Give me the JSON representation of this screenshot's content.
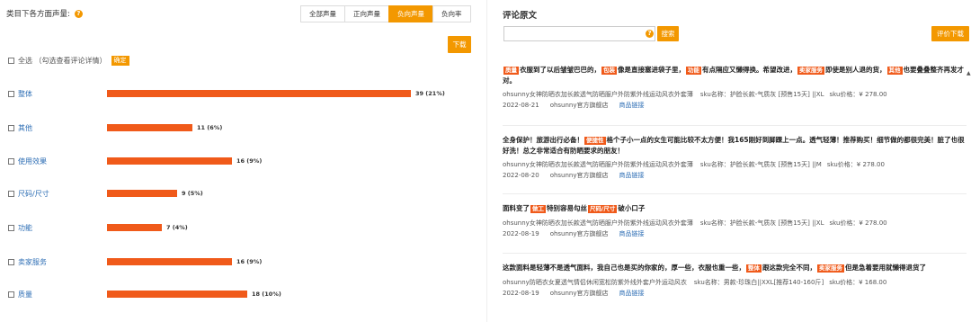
{
  "left": {
    "title": "类目下各方面声量:",
    "help": "?",
    "tabs": [
      "全部声量",
      "正向声量",
      "负向声量",
      "负向率"
    ],
    "active_tab": 2,
    "download_label": "下载",
    "select_all_label": "全选 （勾选查看评论详情）",
    "confirm_label": "确定",
    "aspects": [
      {
        "name": "整体",
        "count": 39,
        "share": "21%",
        "label": "39 (21%)"
      },
      {
        "name": "其他",
        "count": 11,
        "share": "6%",
        "label": "11 (6%)"
      },
      {
        "name": "使用效果",
        "count": 16,
        "share": "9%",
        "label": "16 (9%)"
      },
      {
        "name": "尺码/尺寸",
        "count": 9,
        "share": "5%",
        "label": "9 (5%)"
      },
      {
        "name": "功能",
        "count": 7,
        "share": "4%",
        "label": "7 (4%)"
      },
      {
        "name": "卖家服务",
        "count": 16,
        "share": "9%",
        "label": "16 (9%)"
      },
      {
        "name": "质量",
        "count": 18,
        "share": "10%",
        "label": "18 (10%)"
      }
    ]
  },
  "right": {
    "title": "评论原文",
    "search_placeholder": "",
    "search_label": "搜索",
    "download_label": "评价下载",
    "comments": [
      {
        "segments": [
          {
            "tag": "质量"
          },
          {
            "text": "衣服到了以后皱皱巴巴的，"
          },
          {
            "tag": "包装"
          },
          {
            "text": "像是直接塞进袋子里，"
          },
          {
            "tag": "功能"
          },
          {
            "text": "有点隔应又懒得换。希望改进，"
          },
          {
            "tag": "卖家服务"
          },
          {
            "text": "即使是别人退的货，"
          },
          {
            "tag": "其他"
          },
          {
            "text": "也要叠叠整齐再发才对。"
          }
        ],
        "product": "ohsunny女神防晒衣加长款透气防晒服户外防紫外线运动风衣外套薄",
        "sku": "sku名称：护脸长款-气质灰 [预售15天] ||XL",
        "price": "sku价格：¥ 278.00",
        "date": "2022-08-21",
        "shop": "ohsunny官方旗舰店",
        "link": "商品链接"
      },
      {
        "segments": [
          {
            "text": "全身保护！旅游出行必备！"
          },
          {
            "tag": "便捷性"
          },
          {
            "text": "格个子小一点的女生可能比较不太方便！我165刚好到脚踝上一点。透气轻薄！推荐购买！细节做的都很完美！脏了也很好洗！总之非常适合有防晒要求的朋友！"
          }
        ],
        "product": "ohsunny女神防晒衣加长款透气防晒服户外防紫外线运动风衣外套薄",
        "sku": "sku名称：护脸长款-气质灰 [预售15天] ||M",
        "price": "sku价格：¥ 278.00",
        "date": "2022-08-20",
        "shop": "ohsunny官方旗舰店",
        "link": "商品链接"
      },
      {
        "segments": [
          {
            "text": "面料变了"
          },
          {
            "tag": "做工"
          },
          {
            "text": "特别容易勾丝"
          },
          {
            "tag": "尺码/尺寸"
          },
          {
            "text": "破小口子"
          }
        ],
        "product": "ohsunny女神防晒衣加长款透气防晒服户外防紫外线运动风衣外套薄",
        "sku": "sku名称：护脸长款-气质灰 [预售15天] ||XL",
        "price": "sku价格：¥ 278.00",
        "date": "2022-08-19",
        "shop": "ohsunny官方旗舰店",
        "link": "商品链接"
      },
      {
        "segments": [
          {
            "text": "这款面料是轻薄不是透气面料，我自己也是买的你家的，厚一些，衣服也重一些，"
          },
          {
            "tag": "整体"
          },
          {
            "text": "跟这款完全不同，"
          },
          {
            "tag": "卖家服务"
          },
          {
            "text": "但是急着要用就懒得退货了"
          }
        ],
        "product": "ohsunny防晒衣女夏透气情侣休闲宽松防紫外线外套户外运动风衣",
        "sku": "sku名称：男款-珍珠白||XXL[推荐140-160斤]",
        "price": "sku价格：¥ 168.00",
        "date": "2022-08-19",
        "shop": "ohsunny官方旗舰店",
        "link": "商品链接"
      }
    ]
  }
}
